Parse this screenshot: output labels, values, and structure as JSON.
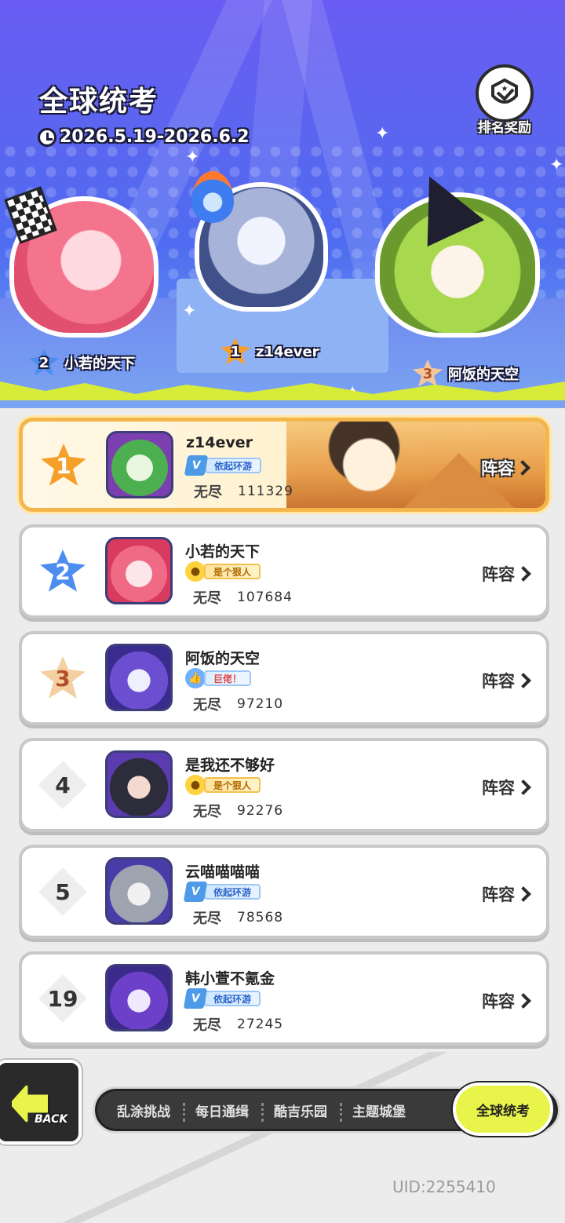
{
  "header": {
    "title": "全球统考",
    "date_range": "2026.5.19-2026.6.2",
    "reward_label": "排名奖励"
  },
  "podium": [
    {
      "rank": "1",
      "name": "z14ever"
    },
    {
      "rank": "2",
      "name": "小若的天下"
    },
    {
      "rank": "3",
      "name": "阿饭的天空"
    }
  ],
  "ranking": [
    {
      "rank": "1",
      "name": "z14ever",
      "tag": "依起环游",
      "tag_icon": "v-icon",
      "mode": "无尽",
      "score": "111329",
      "action": "阵容"
    },
    {
      "rank": "2",
      "name": "小若的天下",
      "tag": "是个狠人",
      "tag_icon": "chick-icon",
      "mode": "无尽",
      "score": "107684",
      "action": "阵容"
    },
    {
      "rank": "3",
      "name": "阿饭的天空",
      "tag": "巨佬！",
      "tag_icon": "good-icon",
      "mode": "无尽",
      "score": "97210",
      "action": "阵容"
    },
    {
      "rank": "4",
      "name": "是我还不够好",
      "tag": "是个狠人",
      "tag_icon": "chick-icon",
      "mode": "无尽",
      "score": "92276",
      "action": "阵容"
    },
    {
      "rank": "5",
      "name": "云喵喵喵喵",
      "tag": "依起环游",
      "tag_icon": "v-icon",
      "mode": "无尽",
      "score": "78568",
      "action": "阵容"
    },
    {
      "rank": "19",
      "name": "韩小萱不氪金",
      "tag": "依起环游",
      "tag_icon": "v-icon",
      "mode": "无尽",
      "score": "27245",
      "action": "阵容"
    }
  ],
  "nav": {
    "back_label": "BACK",
    "tabs": [
      "乱涂挑战",
      "每日通缉",
      "酷吉乐园",
      "主题城堡",
      "全球统考"
    ],
    "active_tab": "全球统考"
  },
  "uid": "UID:2255410",
  "colors": {
    "accent_yellow": "#e8f44a",
    "gold": "#f5a02a",
    "silver_blue": "#4d8df0",
    "bronze": "#f3cfa2",
    "header_purple": "#6a5cf2"
  }
}
